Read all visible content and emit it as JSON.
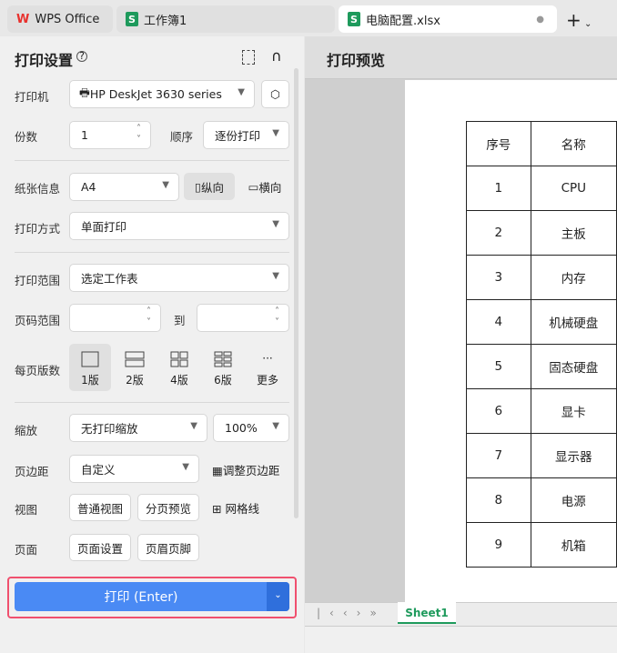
{
  "tabs": [
    {
      "label": "WPS Office"
    },
    {
      "label": "工作簿1"
    },
    {
      "label": "电脑配置.xlsx"
    }
  ],
  "panel": {
    "title": "打印设置",
    "printer_label": "打印机",
    "printer": "HP DeskJet 3630 series",
    "copies_label": "份数",
    "copies": "1",
    "order_label": "顺序",
    "order": "逐份打印",
    "paper_label": "纸张信息",
    "paper": "A4",
    "portrait": "纵向",
    "landscape": "横向",
    "mode_label": "打印方式",
    "mode": "单面打印",
    "range_label": "打印范围",
    "range": "选定工作表",
    "pages_label": "页码范围",
    "to": "到",
    "layout_label": "每页版数",
    "layouts": [
      "1版",
      "2版",
      "4版",
      "6版",
      "更多"
    ],
    "scale_label": "缩放",
    "scale": "无打印缩放",
    "zoom": "100%",
    "margin_label": "页边距",
    "margin": "自定义",
    "adjust_margin": "调整页边距",
    "view_label": "视图",
    "normal_view": "普通视图",
    "page_break": "分页预览",
    "gridlines": "网格线",
    "page_label": "页面",
    "page_setup": "页面设置",
    "header_footer": "页眉页脚",
    "print": "打印 (Enter)"
  },
  "preview": {
    "title": "打印预览",
    "sheet": "Sheet1",
    "headers": [
      "序号",
      "名称"
    ],
    "rows": [
      [
        "1",
        "CPU"
      ],
      [
        "2",
        "主板"
      ],
      [
        "3",
        "内存"
      ],
      [
        "4",
        "机械硬盘"
      ],
      [
        "5",
        "固态硬盘"
      ],
      [
        "6",
        "显卡"
      ],
      [
        "7",
        "显示器"
      ],
      [
        "8",
        "电源"
      ],
      [
        "9",
        "机箱"
      ]
    ]
  },
  "colors": {
    "accent": "#4a8af4",
    "highlight": "#f0506e"
  }
}
